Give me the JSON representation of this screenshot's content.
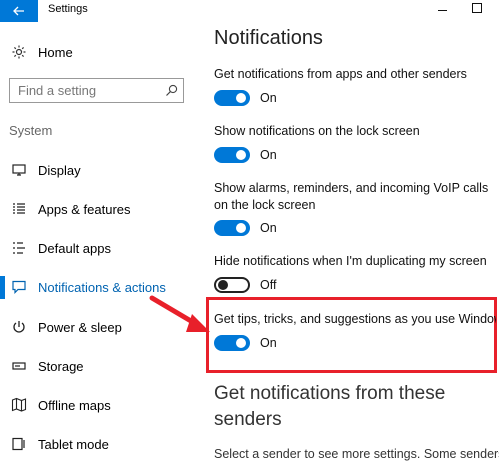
{
  "window": {
    "title": "Settings",
    "accent_color": "#0078d7"
  },
  "sidebar": {
    "home_label": "Home",
    "search_placeholder": "Find a setting",
    "section_label": "System",
    "items": [
      {
        "label": "Display",
        "icon": "display-icon"
      },
      {
        "label": "Apps & features",
        "icon": "apps-features-icon"
      },
      {
        "label": "Default apps",
        "icon": "default-apps-icon"
      },
      {
        "label": "Notifications & actions",
        "icon": "notifications-icon",
        "selected": true
      },
      {
        "label": "Power & sleep",
        "icon": "power-icon"
      },
      {
        "label": "Storage",
        "icon": "storage-icon"
      },
      {
        "label": "Offline maps",
        "icon": "map-icon"
      },
      {
        "label": "Tablet mode",
        "icon": "tablet-icon"
      }
    ]
  },
  "main": {
    "title": "Notifications",
    "settings": [
      {
        "label": "Get notifications from apps and other senders",
        "state": "On",
        "on": true
      },
      {
        "label": "Show notifications on the lock screen",
        "state": "On",
        "on": true
      },
      {
        "label": "Show alarms, reminders, and incoming VoIP calls on the lock screen",
        "state": "On",
        "on": true
      },
      {
        "label": "Hide notifications when I'm duplicating my screen",
        "state": "Off",
        "on": false
      },
      {
        "label": "Get tips, tricks, and suggestions as you use Windows",
        "state": "On",
        "on": true,
        "highlighted": true
      }
    ],
    "senders_heading": "Get notifications from these senders",
    "senders_text": "Select a sender to see more settings. Some senders"
  },
  "annotation": {
    "highlight_color": "#e8202a"
  }
}
